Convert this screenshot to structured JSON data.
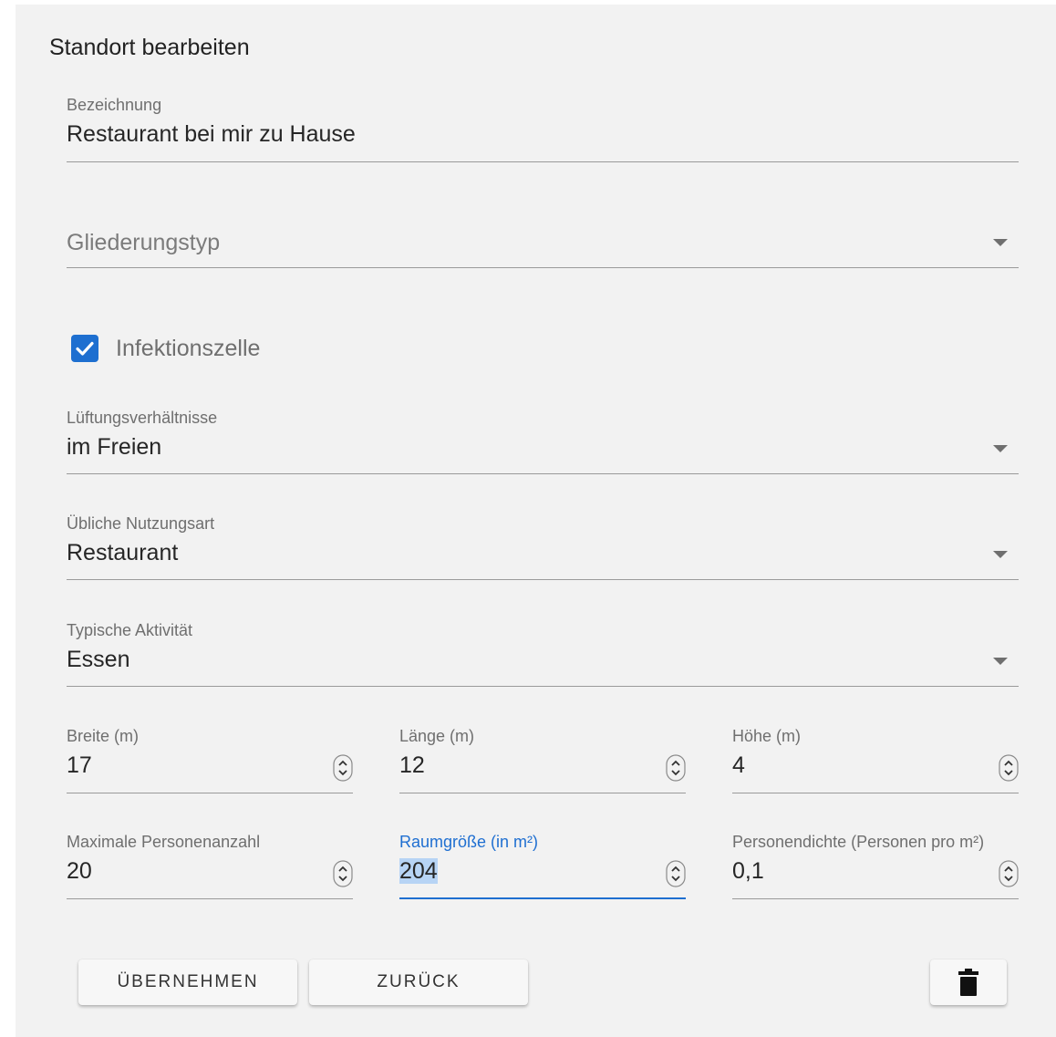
{
  "form": {
    "title": "Standort bearbeiten"
  },
  "fields": {
    "bezeichnung": {
      "label": "Bezeichnung",
      "value": "Restaurant bei mir zu Hause"
    },
    "gliederungstyp": {
      "placeholder": "Gliederungstyp"
    },
    "infektionszelle": {
      "label": "Infektionszelle",
      "checked": true
    },
    "lueftung": {
      "label": "Lüftungsverhältnisse",
      "value": "im Freien"
    },
    "nutzungsart": {
      "label": "Übliche Nutzungsart",
      "value": "Restaurant"
    },
    "aktivitaet": {
      "label": "Typische Aktivität",
      "value": "Essen"
    },
    "breite": {
      "label": "Breite (m)",
      "value": "17"
    },
    "laenge": {
      "label": "Länge (m)",
      "value": "12"
    },
    "hoehe": {
      "label": "Höhe (m)",
      "value": "4"
    },
    "max_personen": {
      "label": "Maximale Personenanzahl",
      "value": "20"
    },
    "raumgroesse": {
      "label": "Raumgröße (in m²)",
      "value": "204"
    },
    "personendichte": {
      "label": "Personendichte (Personen pro m²)",
      "value": "0,1"
    }
  },
  "actions": {
    "apply_label": "ÜBERNEHMEN",
    "back_label": "ZURÜCK",
    "delete_icon": "trash-icon"
  },
  "colors": {
    "accent": "#1e6fd0",
    "card_background": "#f2f2f2"
  }
}
